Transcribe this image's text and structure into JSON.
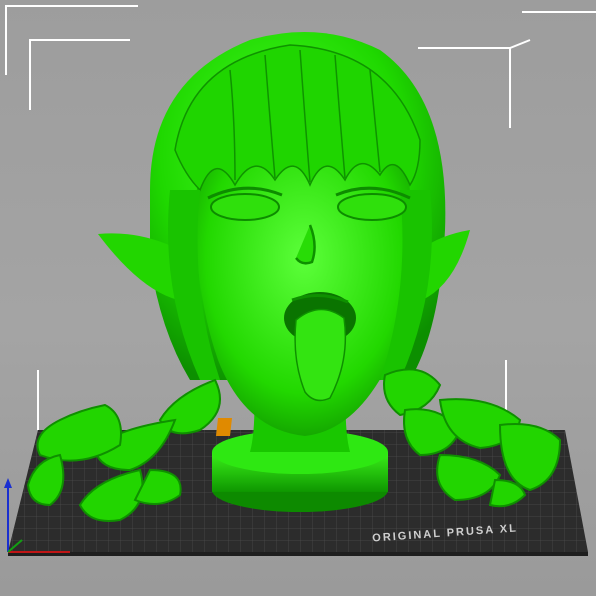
{
  "viewport": {
    "bed_label": "ORIGINAL PRUSA XL",
    "colors": {
      "background": "#9e9e9e",
      "bed": "#2b2b2b",
      "bed_grid": "#4a4a4a",
      "model": "#1fe500",
      "model_shadow": "#0f9a00",
      "bounding_box": "#ffffff",
      "selection_marker": "#e08a00"
    },
    "icons": {
      "axis_gizmo": "axis-gizmo-icon",
      "bounding_corners": "bounding-box-corner-icon"
    }
  }
}
